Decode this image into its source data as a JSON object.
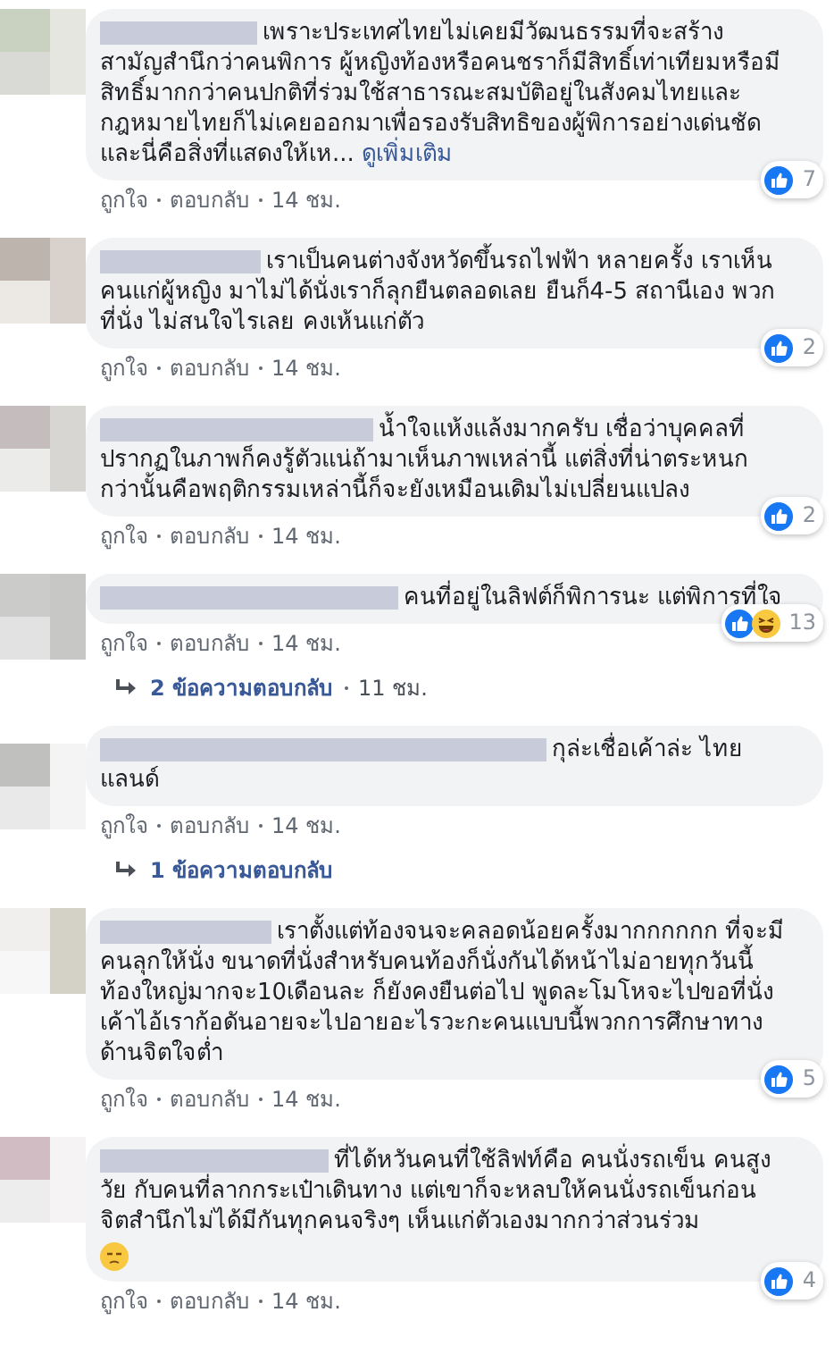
{
  "comments": [
    {
      "text": "เพราะประเทศไทยไม่เคยมีวัฒนธรรมที่จะสร้างสามัญสำนึกว่าคนพิการ ผู้หญิงท้องหรือคนชราก็มีสิทธิ์เท่าเทียมหรือมีสิทธิ์มากกว่าคนปกติที่ร่วมใช้สาธารณะสมบัติอยู่ในสังคมไทยและกฎหมายไทยก็ไม่เคยออกมาเพื่อรองรับสิทธิของผู้พิการอย่างเด่นชัดและนี่คือสิ่งที่แสดงให้เห...",
      "see_more": "ดูเพิ่มเติม",
      "reactions": {
        "like": true,
        "count": "7"
      },
      "actions": [
        "ถูกใจ",
        "ตอบกลับ"
      ],
      "time": "14 ชม."
    },
    {
      "text": "เราเป็นคนต่างจังหวัดขึ้นรถไฟฟ้า หลายครั้ง เราเห็นคนแก่ผู้หญิง มาไม่ได้นั่งเราก็ลุกยืนตลอดเลย ยืนก็4-5 สถานีเอง พวกที่นั่ง ไม่สนใจไรเลย คงเห้นแก่ตัว",
      "reactions": {
        "like": true,
        "count": "2"
      },
      "actions": [
        "ถูกใจ",
        "ตอบกลับ"
      ],
      "time": "14 ชม."
    },
    {
      "text": "น้ำใจแห้งแล้งมากครับ เชื่อว่าบุคคลที่ปรากฏในภาพก็คงรู้ตัวแน่ถ้ามาเห็นภาพเหล่านี้ แต่สิ่งที่น่าตระหนกกว่านั้นคือพฤติกรรมเหล่านี้ก็จะยังเหมือนเดิมไม่เปลี่ยนแปลง",
      "reactions": {
        "like": true,
        "count": "2"
      },
      "actions": [
        "ถูกใจ",
        "ตอบกลับ"
      ],
      "time": "14 ชม."
    },
    {
      "text": "คนที่อยู่ในลิฟต์ก็พิการนะ แต่พิการที่ใจ",
      "reactions": {
        "like": true,
        "haha": true,
        "count": "13"
      },
      "actions": [
        "ถูกใจ",
        "ตอบกลับ"
      ],
      "time": "14 ชม.",
      "replies": {
        "label": "2 ข้อความตอบกลับ",
        "time": "11 ชม."
      }
    },
    {
      "text": "กุล่ะเชื่อเค้าล่ะ ไทยแลนด์",
      "actions": [
        "ถูกใจ",
        "ตอบกลับ"
      ],
      "time": "14 ชม.",
      "replies": {
        "label": "1 ข้อความตอบกลับ"
      }
    },
    {
      "text": "เราตั้งแต่ท้องจนจะคลอดน้อยครั้งมากกกกกก ที่จะมีคนลุกให้นั่ง ขนาดที่นั่งสำหรับคนท้องก็นั่งกันได้หน้าไม่อายทุกวันนี้ท้องใหญ่มากจะ10เดือนละ ก็ยังคงยืนต่อไป พูดละโมโหจะไปขอที่นั่งเค้าไอ้เราก้อดันอายจะไปอายอะไรวะกะคนแบบนี้พวกการศึกษาทางด้านจิตใจต่ำ",
      "reactions": {
        "like": true,
        "count": "5"
      },
      "actions": [
        "ถูกใจ",
        "ตอบกลับ"
      ],
      "time": "14 ชม."
    },
    {
      "text": "ที่ได้หวันคนที่ใช้ลิฟท์คือ คนนั่งรถเข็น คนสูงวัย กับคนที่ลากกระเป๋าเดินทาง แต่เขาก็จะหลบให้คนนั่งรถเข็นก่อน จิตสำนึกไม่ได้มีกันทุกคนจริงๆ เห็นแก่ตัวเองมากกว่าส่วนร่วม",
      "emoji": true,
      "reactions": {
        "like": true,
        "count": "4"
      },
      "actions": [
        "ถูกใจ",
        "ตอบกลับ"
      ],
      "time": "14 ชม."
    }
  ]
}
